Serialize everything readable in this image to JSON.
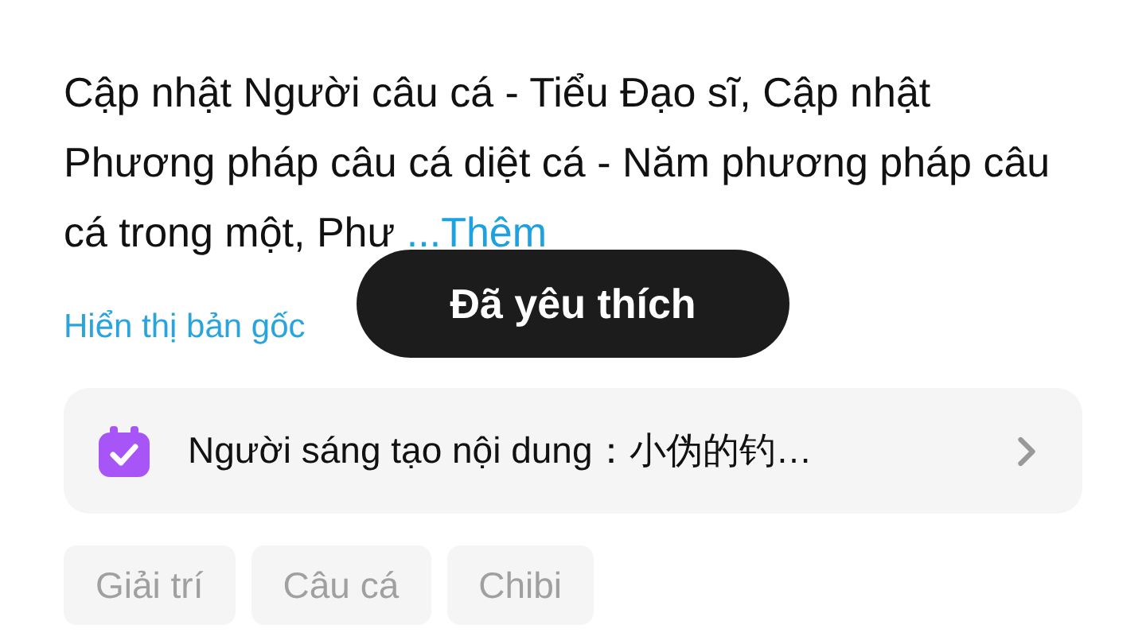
{
  "description": {
    "text": "Cập nhật Người câu cá - Tiểu Đạo sĩ, Cập nhật Phương pháp câu cá diệt cá - Năm phương pháp câu cá trong một, Phư",
    "more": "...Thêm"
  },
  "show_original": "Hiển thị bản gốc",
  "toast": "Đã yêu thích",
  "creator": {
    "label": "Người sáng tạo nội dung：小伪的钓…"
  },
  "tags": [
    "Giải trí",
    "Câu cá",
    "Chibi"
  ]
}
